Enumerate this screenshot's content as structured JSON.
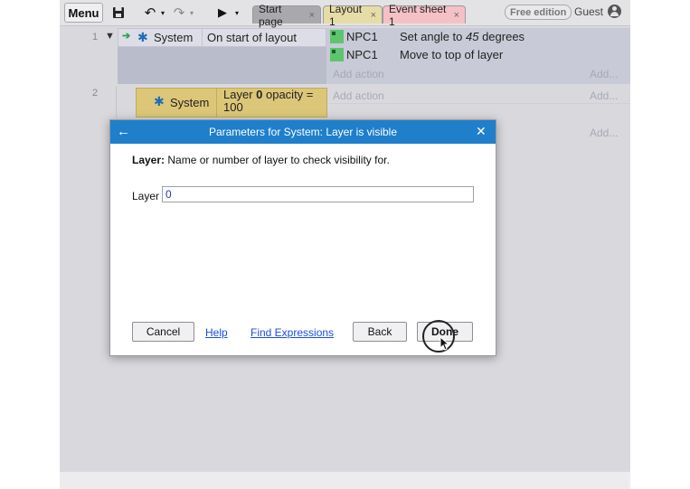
{
  "toolbar": {
    "menu_label": "Menu",
    "tabs": [
      {
        "label": "Start page"
      },
      {
        "label": "Layout 1"
      },
      {
        "label": "Event sheet 1"
      }
    ],
    "close_glyph": "×",
    "free_badge": "Free edition",
    "guest_label": "Guest"
  },
  "events": [
    {
      "number": "1",
      "condition": {
        "object": "System",
        "text": "On start of layout"
      },
      "actions": [
        {
          "object": "NPC1",
          "text_before": "Set angle to ",
          "text_em": "45",
          "text_after": " degrees"
        },
        {
          "object": "NPC1",
          "text": "Move to top of layer"
        }
      ],
      "add_action": "Add action",
      "add_right": "Add..."
    },
    {
      "number": "2",
      "condition": {
        "object": "System",
        "text_before": "Layer ",
        "text_bold": "0",
        "text_after": " opacity = 100"
      },
      "add_action": "Add action",
      "add_right": "Add..."
    }
  ],
  "row3": {
    "add_right": "Add..."
  },
  "dialog": {
    "title": "Parameters for System: Layer is visible",
    "desc_bold": "Layer:",
    "desc_text": " Name or number of layer to check visibility for.",
    "field_label": "Layer",
    "field_value": "0",
    "buttons": {
      "cancel": "Cancel",
      "help": "Help",
      "find_expressions": "Find Expressions",
      "back": "Back",
      "done": "Done"
    }
  },
  "icons": {
    "save": "save-icon",
    "undo": "undo-icon",
    "redo": "redo-icon",
    "play": "play-icon",
    "user": "user-icon",
    "gear": "gear-icon",
    "npc": "sprite-icon"
  },
  "colors": {
    "title_bar": "#1f7fcb",
    "link": "#1a4fd6",
    "condition_highlight": "#dcc677",
    "layout_tab": "#e6dca8",
    "event_tab": "#f4c1c6",
    "sprite_icon": "#5dc56e"
  }
}
